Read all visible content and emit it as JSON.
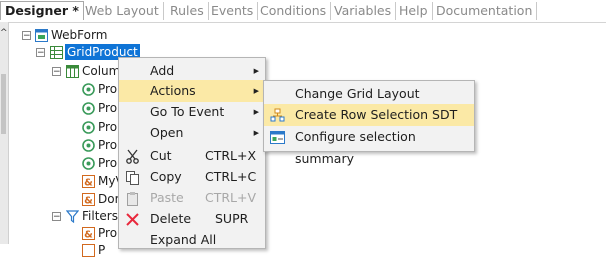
{
  "tabs": [
    {
      "label": "Designer *",
      "active": true
    },
    {
      "label": "Web Layout",
      "active": false
    },
    {
      "label": "Rules",
      "active": false
    },
    {
      "label": "Events",
      "active": false
    },
    {
      "label": "Conditions",
      "active": false
    },
    {
      "label": "Variables",
      "active": false
    },
    {
      "label": "Help",
      "active": false
    },
    {
      "label": "Documentation",
      "active": false
    }
  ],
  "tree": {
    "webform": "WebForm",
    "grid": "GridProduct",
    "columns": "Colum",
    "column_items": [
      "Pro",
      "Pro",
      "Pro",
      "Pro",
      "Pro",
      "MyV",
      "Dor"
    ],
    "filters": "Filters",
    "filter_items": [
      "Pro",
      "P"
    ]
  },
  "context_menu": {
    "items": [
      {
        "label": "Add",
        "shortcut": "",
        "submenu": true
      },
      {
        "label": "Actions",
        "shortcut": "",
        "submenu": true,
        "highlighted": true
      },
      {
        "label": "Go To Event",
        "shortcut": "",
        "submenu": true
      },
      {
        "label": "Open",
        "shortcut": "",
        "submenu": true
      },
      {
        "label": "Cut",
        "shortcut": "CTRL+X",
        "icon": "scissors-icon"
      },
      {
        "label": "Copy",
        "shortcut": "CTRL+C",
        "icon": "copy-icon"
      },
      {
        "label": "Paste",
        "shortcut": "CTRL+V",
        "icon": "paste-icon",
        "disabled": true
      },
      {
        "label": "Delete",
        "shortcut": "SUPR",
        "icon": "delete-icon"
      },
      {
        "label": "Expand All",
        "shortcut": ""
      }
    ]
  },
  "actions_submenu": {
    "items": [
      {
        "label": "Change Grid Layout"
      },
      {
        "label": "Create Row Selection SDT",
        "icon": "sdt-icon",
        "highlighted": true
      },
      {
        "label": "Configure selection summary",
        "icon": "summary-icon"
      }
    ]
  },
  "colors": {
    "selection": "#0f74d6",
    "menu_highlight": "#fbe9a6",
    "menu_bg": "#f2f2f2"
  }
}
